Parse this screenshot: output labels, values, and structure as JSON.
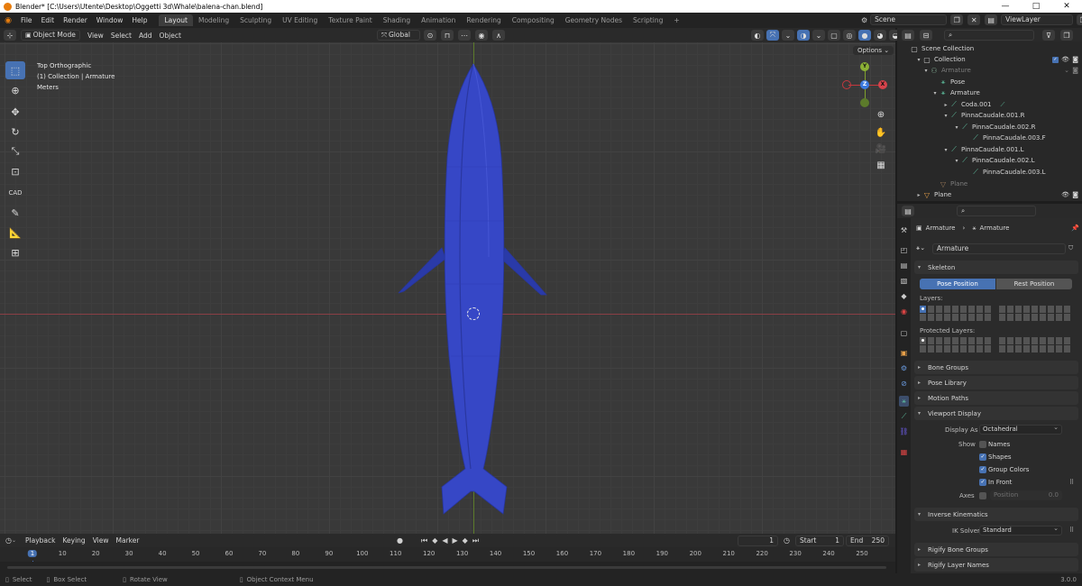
{
  "window": {
    "title": "Blender* [C:\\Users\\Utente\\Desktop\\Oggetti 3d\\Whale\\balena-chan.blend]",
    "controls": [
      "—",
      "□",
      "✕"
    ]
  },
  "menu": [
    "File",
    "Edit",
    "Render",
    "Window",
    "Help"
  ],
  "workspaces": [
    "Layout",
    "Modeling",
    "Sculpting",
    "UV Editing",
    "Texture Paint",
    "Shading",
    "Animation",
    "Rendering",
    "Compositing",
    "Geometry Nodes",
    "Scripting",
    "+"
  ],
  "scene": {
    "label": "Scene",
    "view_layer": "ViewLayer"
  },
  "viewport_header": {
    "mode": "Object Mode",
    "items": [
      "View",
      "Select",
      "Add",
      "Object"
    ],
    "transform": "Global"
  },
  "viewport": {
    "view_name": "Top Orthographic",
    "collection_info": "(1) Collection | Armature",
    "units": "Meters",
    "options": "Options",
    "gizmo": {
      "y": "Y",
      "x": "X",
      "z": "Z"
    },
    "accent_blue": "#3b4fc8",
    "grid_color": "#393939"
  },
  "tools": [
    "select-box",
    "cursor",
    "move",
    "rotate",
    "scale",
    "transform",
    "CAD",
    "annotate",
    "measure",
    "add-cube"
  ],
  "timeline": {
    "menu": [
      "Playback",
      "Keying",
      "View",
      "Marker"
    ],
    "current_frame": "1",
    "start_label": "Start",
    "start": "1",
    "end_label": "End",
    "end": "250",
    "ticks": [
      "1",
      "10",
      "20",
      "30",
      "40",
      "50",
      "60",
      "70",
      "80",
      "90",
      "100",
      "110",
      "120",
      "130",
      "140",
      "150",
      "160",
      "170",
      "180",
      "190",
      "200",
      "210",
      "220",
      "230",
      "240",
      "250"
    ]
  },
  "statusbar": {
    "select": "Select",
    "box_select": "Box Select",
    "rotate_view": "Rotate View",
    "context_menu": "Object Context Menu",
    "version": "3.0.0"
  },
  "outliner": {
    "rows": [
      {
        "label": "Scene Collection",
        "indent": 0
      },
      {
        "label": "Collection",
        "indent": 1
      },
      {
        "label": "Armature",
        "indent": 2
      },
      {
        "label": "Pose",
        "indent": 3
      },
      {
        "label": "Armature",
        "indent": 3
      },
      {
        "label": "Coda.001",
        "indent": 4
      },
      {
        "label": "PinnaCaudale.001.R",
        "indent": 4
      },
      {
        "label": "PinnaCaudale.002.R",
        "indent": 5
      },
      {
        "label": "PinnaCaudale.003.F",
        "indent": 6
      },
      {
        "label": "PinnaCaudale.001.L",
        "indent": 4
      },
      {
        "label": "PinnaCaudale.002.L",
        "indent": 5
      },
      {
        "label": "PinnaCaudale.003.L",
        "indent": 6
      },
      {
        "label": "Plane",
        "indent": 3
      },
      {
        "label": "Plane",
        "indent": 0
      }
    ]
  },
  "properties": {
    "breadcrumb": [
      "Armature",
      "Armature"
    ],
    "data_name": "Armature",
    "skeleton": {
      "header": "Skeleton",
      "pose_position": "Pose Position",
      "rest_position": "Rest Position",
      "layers": "Layers:",
      "protected_layers": "Protected Layers:"
    },
    "panels": {
      "bone_groups": "Bone Groups",
      "pose_library": "Pose Library",
      "motion_paths": "Motion Paths",
      "viewport_display": "Viewport Display",
      "inverse_kinematics": "Inverse Kinematics",
      "rigify_bone_groups": "Rigify Bone Groups",
      "rigify_layer_names": "Rigify Layer Names"
    },
    "viewport_display": {
      "display_as_label": "Display As",
      "display_as": "Octahedral",
      "show_label": "Show",
      "names": "Names",
      "shapes": "Shapes",
      "group_colors": "Group Colors",
      "in_front": "In Front",
      "axes_label": "Axes",
      "position_label": "Position",
      "position_value": "0.0"
    },
    "ik": {
      "solver_label": "IK Solver",
      "solver": "Standard"
    }
  }
}
